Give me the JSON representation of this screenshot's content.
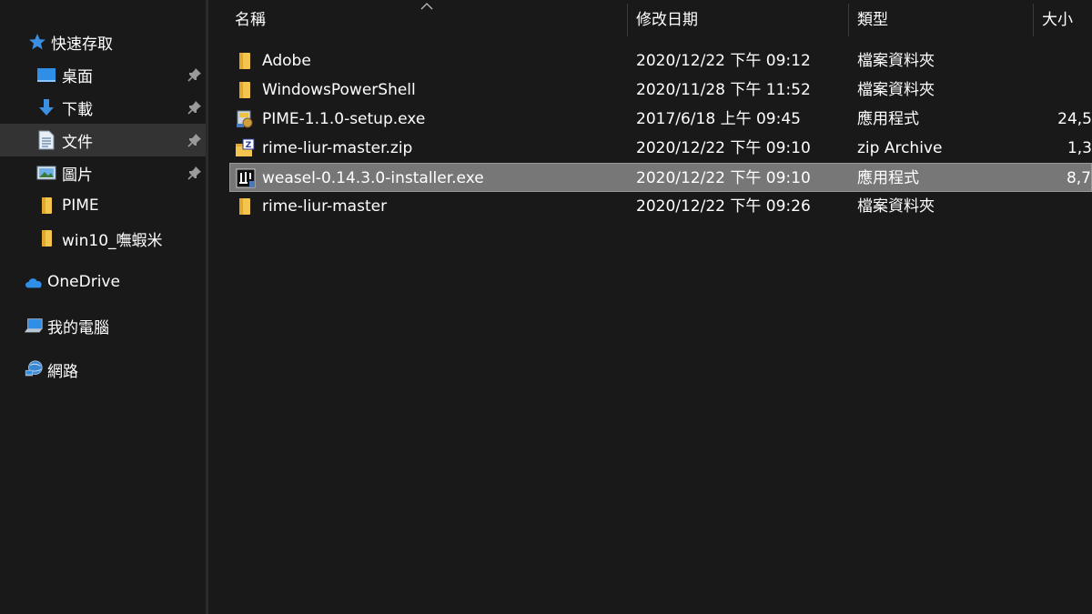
{
  "header": {
    "name_label": "名稱",
    "date_label": "修改日期",
    "type_label": "類型",
    "size_label": "大小"
  },
  "nav": {
    "quick_access": "快速存取",
    "items": [
      {
        "label": "桌面",
        "icon": "desktop-icon",
        "pinned": true
      },
      {
        "label": "下載",
        "icon": "download-icon",
        "pinned": true
      },
      {
        "label": "文件",
        "icon": "document-icon",
        "pinned": true
      },
      {
        "label": "圖片",
        "icon": "pictures-icon",
        "pinned": true
      },
      {
        "label": "PIME",
        "icon": "folder-icon",
        "pinned": false
      },
      {
        "label": "win10_嘸蝦米",
        "icon": "folder-icon",
        "pinned": false
      }
    ],
    "onedrive": "OneDrive",
    "this_pc": "我的電腦",
    "network": "網路"
  },
  "files": [
    {
      "name": "Adobe",
      "date": "2020/12/22 下午 09:12",
      "type": "檔案資料夾",
      "size": "",
      "icon": "folder-icon"
    },
    {
      "name": "WindowsPowerShell",
      "date": "2020/11/28 下午 11:52",
      "type": "檔案資料夾",
      "size": "",
      "icon": "folder-icon"
    },
    {
      "name": "PIME-1.1.0-setup.exe",
      "date": "2017/6/18 上午 09:45",
      "type": "應用程式",
      "size": "24,5",
      "icon": "installer-icon"
    },
    {
      "name": "rime-liur-master.zip",
      "date": "2020/12/22 下午 09:10",
      "type": "zip Archive",
      "size": "1,3",
      "icon": "zip-icon"
    },
    {
      "name": "weasel-0.14.3.0-installer.exe",
      "date": "2020/12/22 下午 09:10",
      "type": "應用程式",
      "size": "8,7",
      "icon": "weasel-icon"
    },
    {
      "name": "rime-liur-master",
      "date": "2020/12/22 下午 09:26",
      "type": "檔案資料夾",
      "size": "",
      "icon": "folder-icon"
    }
  ],
  "colors": {
    "background": "#191919",
    "selected_row": "#777777",
    "selected_nav": "#333333",
    "folder": "#f3c44e",
    "accent_blue": "#3b8fe0"
  }
}
